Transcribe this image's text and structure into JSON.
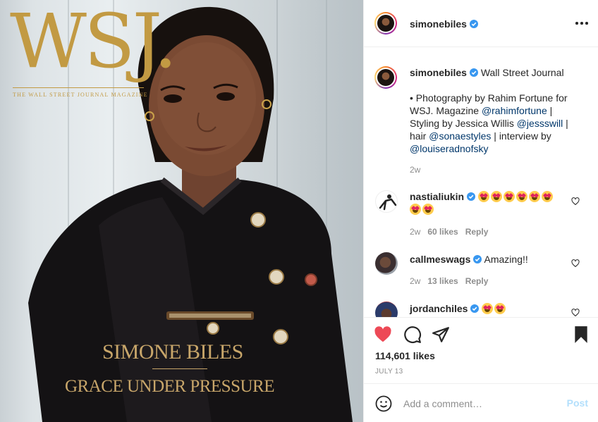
{
  "photo": {
    "logo_text": "WSJ.",
    "logo_tagline": "THE WALL STREET JOURNAL MAGAZINE",
    "cover_name": "SIMONE BILES",
    "cover_subtitle": "GRACE UNDER PRESSURE"
  },
  "header": {
    "username": "simonebiles",
    "verified_icon": "verified-badge-icon",
    "more_icon": "more-options-icon"
  },
  "caption": {
    "username": "simonebiles",
    "line1": "Wall Street Journal",
    "bullet_text": "• Photography by Rahim Fortune for WSJ. Magazine",
    "mention_1": "@rahimfortune",
    "sep_1": " | Styling by Jessica Willis",
    "mention_2": "@jessswill",
    "sep_2": " | hair",
    "mention_3": "@sonaestyles",
    "sep_3": " | interview by",
    "mention_4": "@louiseradnofsky",
    "time": "2w"
  },
  "comments": [
    {
      "username": "nastialiukin",
      "emoji_count": 8,
      "time": "2w",
      "likes": "60 likes",
      "reply": "Reply"
    },
    {
      "username": "callmeswags",
      "text": "Amazing!!",
      "time": "2w",
      "likes": "13 likes",
      "reply": "Reply"
    },
    {
      "username": "jordanchiles",
      "emoji_count": 2
    }
  ],
  "actions": {
    "likes": "114,601 likes",
    "date": "JULY 13",
    "liked": true,
    "saved": true
  },
  "add_comment": {
    "placeholder": "Add a comment…",
    "post_label": "Post"
  },
  "colors": {
    "gold": "#c29a43",
    "heart": "#ed4956",
    "verified": "#3897f0",
    "mention": "#00376b",
    "post_disabled": "#b2dffc"
  }
}
